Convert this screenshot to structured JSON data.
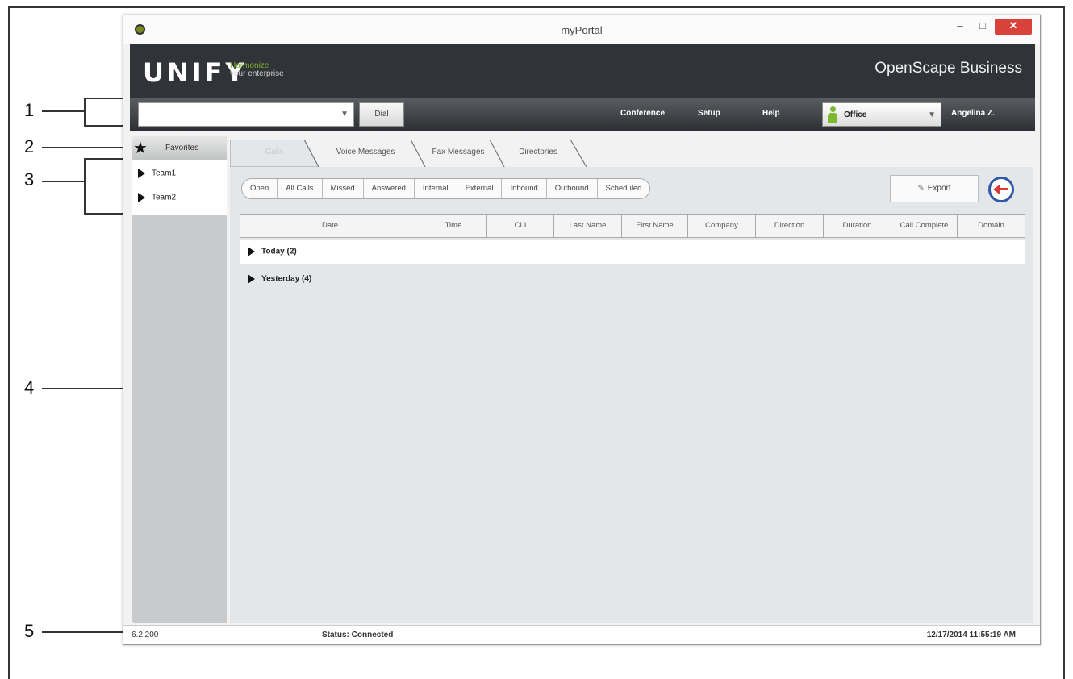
{
  "window": {
    "title": "myPortal",
    "minimize": "–",
    "maximize": "□",
    "close": "✕"
  },
  "brand": {
    "logo": "UNIFY",
    "tagline_line1": "Harmonize",
    "tagline_line2": "your enterprise",
    "product": "OpenScape Business"
  },
  "toolbar": {
    "dial_value": "",
    "dial_button": "Dial",
    "menu": [
      "Conference",
      "Setup",
      "Help"
    ],
    "status": "Office",
    "user": "Angelina Z."
  },
  "sidebar": {
    "favorites_label": "Favorites",
    "teams": [
      "Team1",
      "Team2"
    ]
  },
  "tabs": [
    "Calls",
    "Voice Messages",
    "Fax Messages",
    "Directories"
  ],
  "filters": [
    "Open",
    "All Calls",
    "Missed",
    "Answered",
    "Internal",
    "External",
    "Inbound",
    "Outbound",
    "Scheduled"
  ],
  "export_label": "Export",
  "columns": [
    "Date",
    "Time",
    "CLI",
    "Last Name",
    "First Name",
    "Company",
    "Direction",
    "Duration",
    "Call Complete",
    "Domain"
  ],
  "groups": [
    "Today (2)",
    "Yesterday (4)"
  ],
  "statusbar": {
    "version": "6.2.200",
    "status": "Status: Connected",
    "datetime": "12/17/2014 11:55:19 AM"
  },
  "callouts": [
    "1",
    "2",
    "3",
    "4",
    "5"
  ],
  "colors": {
    "accent_green": "#7fae2e",
    "close_red": "#d9413b",
    "brand_dark": "#303438",
    "logout_blue": "#2f59a6"
  }
}
